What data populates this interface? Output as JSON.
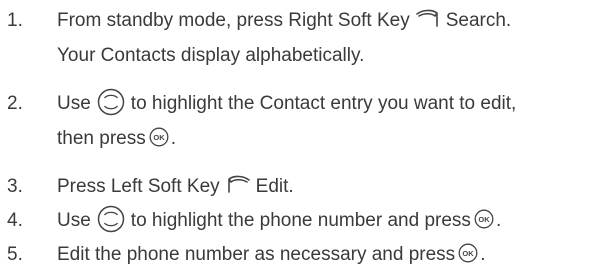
{
  "steps": [
    {
      "number": "1.",
      "line1_a": "From standby mode, press Right Soft Key",
      "line1_icon": "right-soft-key-icon",
      "line1_b": "Search.",
      "line2": "Your Contacts display alphabetically."
    },
    {
      "number": "2.",
      "line1_a": "Use",
      "line1_icon": "nav-key-icon",
      "line1_b": "to highlight the Contact entry you want to edit,",
      "line2_a": "then press",
      "line2_icon": "ok-key-icon",
      "line2_b": "."
    },
    {
      "number": "3.",
      "line1_a": "Press Left Soft Key",
      "line1_icon": "left-soft-key-icon",
      "line1_b": "Edit."
    },
    {
      "number": "4.",
      "line1_a": "Use",
      "line1_icon": "nav-key-icon",
      "line1_b": "to highlight the phone number and press",
      "line1_icon2": "ok-key-icon",
      "line1_c": "."
    },
    {
      "number": "5.",
      "line1_a": "Edit the phone number as necessary and press",
      "line1_icon": "ok-key-icon",
      "line1_b": "."
    }
  ]
}
